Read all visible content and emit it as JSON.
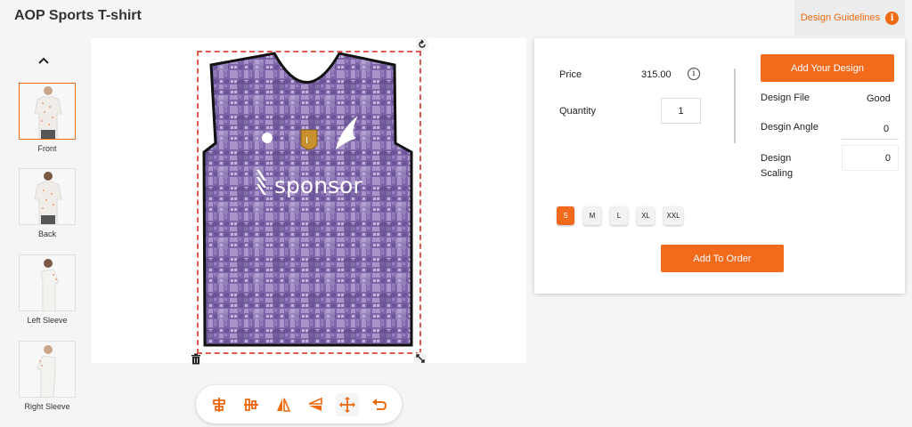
{
  "header": {
    "title": "AOP Sports T-shirt",
    "guidelines_label": "Design Guidelines"
  },
  "views": [
    {
      "label": "Front",
      "active": true
    },
    {
      "label": "Back",
      "active": false
    },
    {
      "label": "Left Sleeve",
      "active": false
    },
    {
      "label": "Right Sleeve",
      "active": false
    }
  ],
  "design": {
    "logo_text": "sponsor"
  },
  "panel": {
    "price_label": "Price",
    "price_value": "315.00",
    "quantity_label": "Quantity",
    "quantity_value": "1",
    "add_design_label": "Add Your Design",
    "design_file_label": "Design File",
    "design_file_value": "Good",
    "design_angle_label": "Desgin Angle",
    "design_angle_value": "0",
    "design_scaling_label": "Design Scaling",
    "design_scaling_value": "0",
    "sizes": [
      "S",
      "M",
      "L",
      "XL",
      "XXL"
    ],
    "selected_size": "S",
    "add_order_label": "Add To Order"
  },
  "toolbar": {
    "tools": [
      "align-center-horizontal-icon",
      "align-center-vertical-icon",
      "flip-horizontal-icon",
      "flip-vertical-icon",
      "move-icon",
      "undo-icon"
    ]
  },
  "colors": {
    "accent": "#f26b1d",
    "jersey": "#7e66a8",
    "jersey_dark": "#5e4a8a",
    "selection": "#e05a4f"
  }
}
